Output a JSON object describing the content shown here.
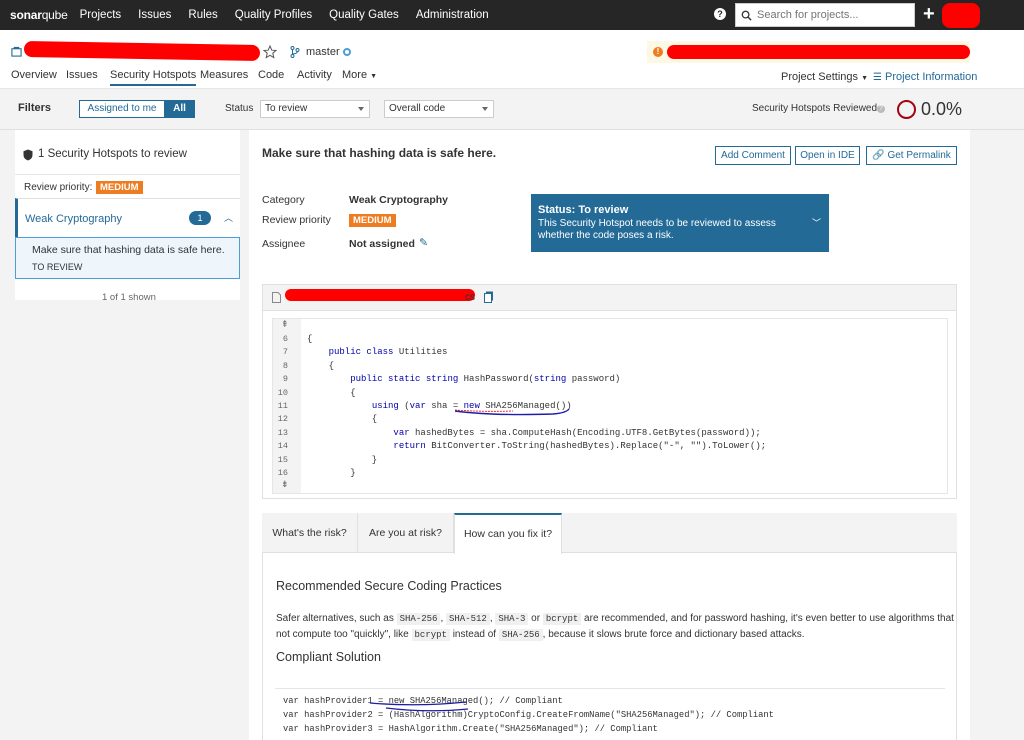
{
  "topnav": {
    "logo_a": "sonar",
    "logo_b": "qube",
    "links": [
      "Projects",
      "Issues",
      "Rules",
      "Quality Profiles",
      "Quality Gates",
      "Administration"
    ],
    "search_placeholder": "Search for projects...",
    "help": "?",
    "plus": "+"
  },
  "project": {
    "branch": "master",
    "tabs": [
      "Overview",
      "Issues",
      "Security Hotspots",
      "Measures",
      "Code",
      "Activity",
      "More"
    ],
    "settings": "Project Settings",
    "info": "Project Information"
  },
  "filters": {
    "title": "Filters",
    "assigned": "Assigned to me",
    "all": "All",
    "status_label": "Status",
    "status_value": "To review",
    "code_value": "Overall code",
    "reviewed_label": "Security Hotspots Reviewed",
    "reviewed_value": "0.0%",
    "reviewed_fraction": 0.0
  },
  "left": {
    "count": "1 Security Hotspots to review",
    "priority_label": "Review priority:",
    "priority_value": "MEDIUM",
    "category": "Weak Cryptography",
    "category_count": "1",
    "hotspot_title": "Make sure that hashing data is safe here.",
    "hotspot_status": "TO REVIEW",
    "shown": "1 of 1 shown"
  },
  "main": {
    "title": "Make sure that hashing data is safe here.",
    "btn_comment": "Add Comment",
    "btn_ide": "Open in IDE",
    "btn_permalink": "Get Permalink",
    "category_label": "Category",
    "category_value": "Weak Cryptography",
    "priority_label": "Review priority",
    "priority_value": "MEDIUM",
    "assignee_label": "Assignee",
    "assignee_value": "Not assigned",
    "status_title": "Status: To review",
    "status_desc": "This Security Hotspot needs to be reviewed to assess whether the code poses a risk.",
    "file_suffix": "cs"
  },
  "code": {
    "lines": [
      {
        "n": "6",
        "t": "{"
      },
      {
        "n": "7",
        "t": "    public class Utilities"
      },
      {
        "n": "8",
        "t": "    {"
      },
      {
        "n": "9",
        "t": "        public static string HashPassword(string password)"
      },
      {
        "n": "10",
        "t": "        {"
      },
      {
        "n": "11",
        "t": "            using (var sha = new SHA256Managed())"
      },
      {
        "n": "12",
        "t": "            {"
      },
      {
        "n": "13",
        "t": "                var hashedBytes = sha.ComputeHash(Encoding.UTF8.GetBytes(password));"
      },
      {
        "n": "14",
        "t": "                return BitConverter.ToString(hashedBytes).Replace(\"-\", \"\").ToLower();"
      },
      {
        "n": "15",
        "t": "            }"
      },
      {
        "n": "16",
        "t": "        }"
      }
    ]
  },
  "risk": {
    "tabs": [
      "What's the risk?",
      "Are you at risk?",
      "How can you fix it?"
    ],
    "heading1": "Recommended Secure Coding Practices",
    "p1": "Safer alternatives, such as",
    "c1": "SHA-256",
    "c2": "SHA-512",
    "c3": "SHA-3",
    "p_or": "or",
    "c4": "bcrypt",
    "p2": "are recommended, and for password hashing, it's even better to use algorithms that",
    "p3": "not compute too \"quickly\", like",
    "c5": "bcrypt",
    "p4": "instead of",
    "c6": "SHA-256",
    "p5": ", because it slows brute force and dictionary based attacks.",
    "heading2": "Compliant Solution",
    "snippet": [
      "var hashProvider1 = new SHA256Managed(); // Compliant",
      "var hashProvider2 = (HashAlgorithm)CryptoConfig.CreateFromName(\"SHA256Managed\"); // Compliant",
      "var hashProvider3 = HashAlgorithm.Create(\"SHA256Managed\"); // Compliant"
    ]
  },
  "colors": {
    "accent": "#236a97",
    "medium": "#ed7d20",
    "topbar": "#262626",
    "redaction": "#ff0000"
  }
}
